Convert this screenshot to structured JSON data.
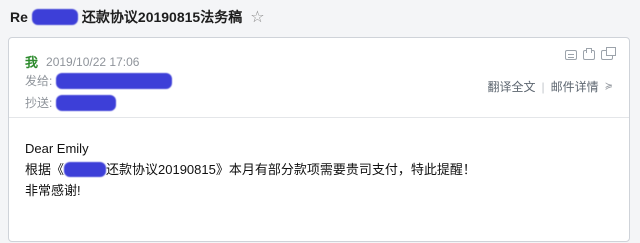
{
  "title": {
    "prefix": "Re",
    "subject": "还款协议20190815法务稿",
    "star": "☆"
  },
  "header": {
    "me_label": "我",
    "datetime": "2019/10/22 17:06",
    "from_label": "发给:",
    "cc_label": "抄送:",
    "tool_icons": [
      "document-icon",
      "print-icon",
      "new-window-icon"
    ],
    "translate_label": "翻译全文",
    "details_label": "邮件详情",
    "sep": "|",
    "dropdown": "≽"
  },
  "body": {
    "greeting": "Dear Emily",
    "line2_a": "根据《",
    "line2_b": "还款协议20190815》本月有部分款项需要贵司支付，特此提醒！",
    "line3": "非常感谢!"
  },
  "colors": {
    "redaction": "#3d3fd8",
    "me": "#2e8b2e",
    "muted": "#8f949b"
  }
}
